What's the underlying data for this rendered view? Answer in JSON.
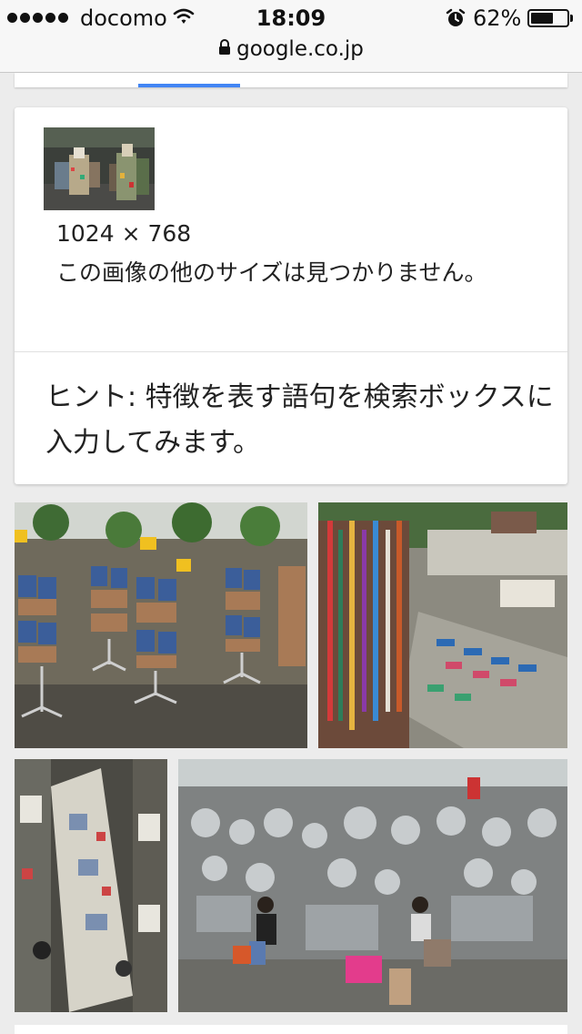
{
  "status_bar": {
    "carrier": "docomo",
    "time": "18:09",
    "battery_percent": "62%",
    "battery_level": 0.62,
    "icons": [
      "signal-dots-icon",
      "wifi-icon",
      "alarm-clock-icon",
      "battery-icon"
    ]
  },
  "url_bar": {
    "domain": "google.co.jp",
    "icon": "lock-icon"
  },
  "tabs": {
    "accent_color": "#4285f4"
  },
  "image_info": {
    "dimensions": "1024 × 768",
    "no_other_sizes": "この画像の他のサイズは見つかりません。"
  },
  "hint": {
    "text": "ヒント: 特徴を表す語句を検索ボックスに入力してみます。"
  },
  "results": [
    {
      "name": "result-image-1",
      "subject": "market stall with hanging merchandise racks"
    },
    {
      "name": "result-image-2",
      "subject": "market stall with necklaces and items on cloth"
    },
    {
      "name": "result-image-3",
      "subject": "aerial view of market aisle"
    },
    {
      "name": "result-image-4",
      "subject": "kitchenware shop with seated vendors"
    }
  ]
}
